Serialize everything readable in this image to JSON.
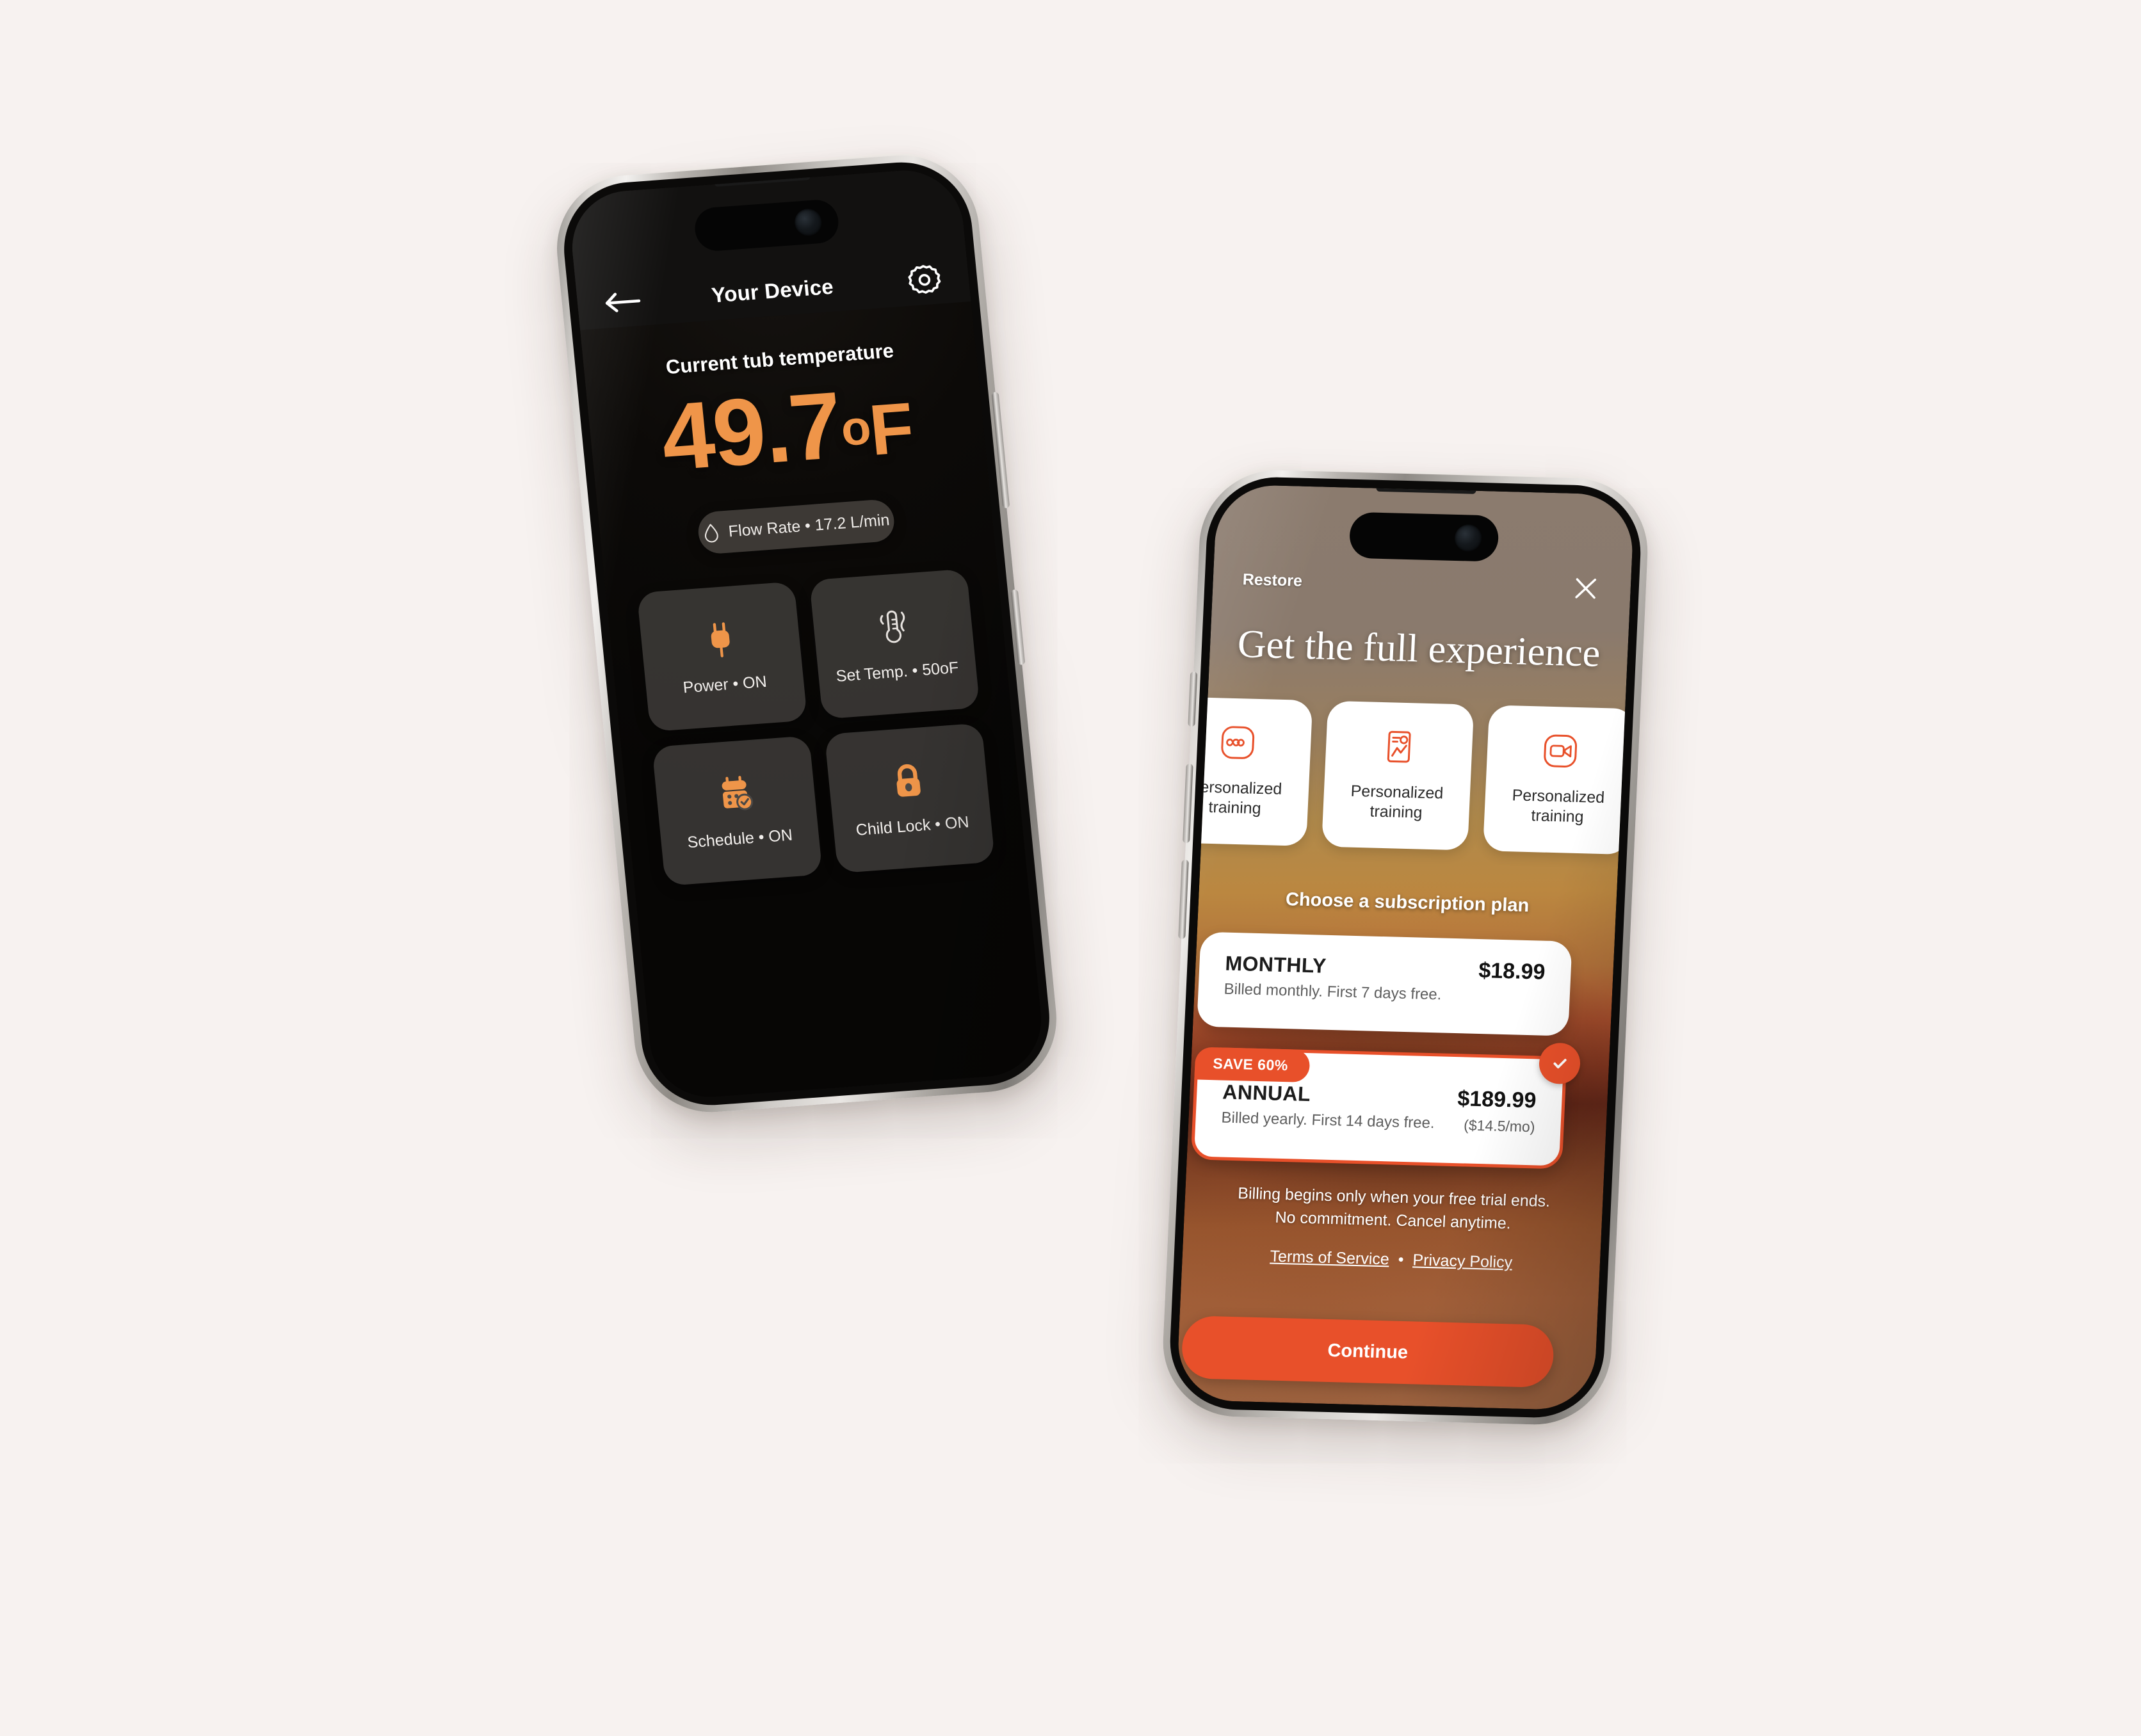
{
  "page": {
    "background_color": "#F7F2F0"
  },
  "phone_device": {
    "nav": {
      "back_icon": "arrow-left-icon",
      "title": "Your Device",
      "settings_icon": "gear-icon"
    },
    "temperature": {
      "label": "Current tub temperature",
      "value": "49.7",
      "degree_symbol": "o",
      "unit": "F",
      "color": "#EF9549"
    },
    "flow_rate": {
      "icon": "water-drop-icon",
      "text": "Flow Rate • 17.2 L/min"
    },
    "tiles": [
      {
        "icon": "power-plug-icon",
        "label": "Power • ON",
        "icon_color": "#EF9549"
      },
      {
        "icon": "thermometer-icon",
        "label": "Set Temp. • 50oF",
        "icon_color": "#E6E2DE"
      },
      {
        "icon": "calendar-check-icon",
        "label": "Schedule • ON",
        "icon_color": "#EF9549"
      },
      {
        "icon": "padlock-icon",
        "label": "Child Lock • ON",
        "icon_color": "#EF9549"
      }
    ]
  },
  "phone_paywall": {
    "accent_color": "#E8502A",
    "top": {
      "restore_label": "Restore",
      "close_icon": "close-icon"
    },
    "heading": "Get the full experience",
    "features": [
      {
        "icon": "infinity-icon",
        "label": "Personalized\ntraining"
      },
      {
        "icon": "document-chart-icon",
        "label": "Personalized\ntraining"
      },
      {
        "icon": "video-camera-icon",
        "label": "Personalized\ntraining"
      }
    ],
    "choose_plan_label": "Choose a subscription plan",
    "plans": [
      {
        "name": "MONTHLY",
        "subtitle": "Billed monthly. First 7 days free.",
        "price": "$18.99",
        "per_month": "",
        "badge": "",
        "selected": false
      },
      {
        "name": "ANNUAL",
        "subtitle": "Billed yearly. First 14 days free.",
        "price": "$189.99",
        "per_month": "($14.5/mo)",
        "badge": "SAVE 60%",
        "selected": true
      }
    ],
    "terms_line1": "Billing begins only when your free trial ends.",
    "terms_line2": "No commitment. Cancel anytime.",
    "links": {
      "terms": "Terms of Service",
      "separator": "•",
      "privacy": "Privacy Policy"
    },
    "continue_label": "Continue"
  }
}
